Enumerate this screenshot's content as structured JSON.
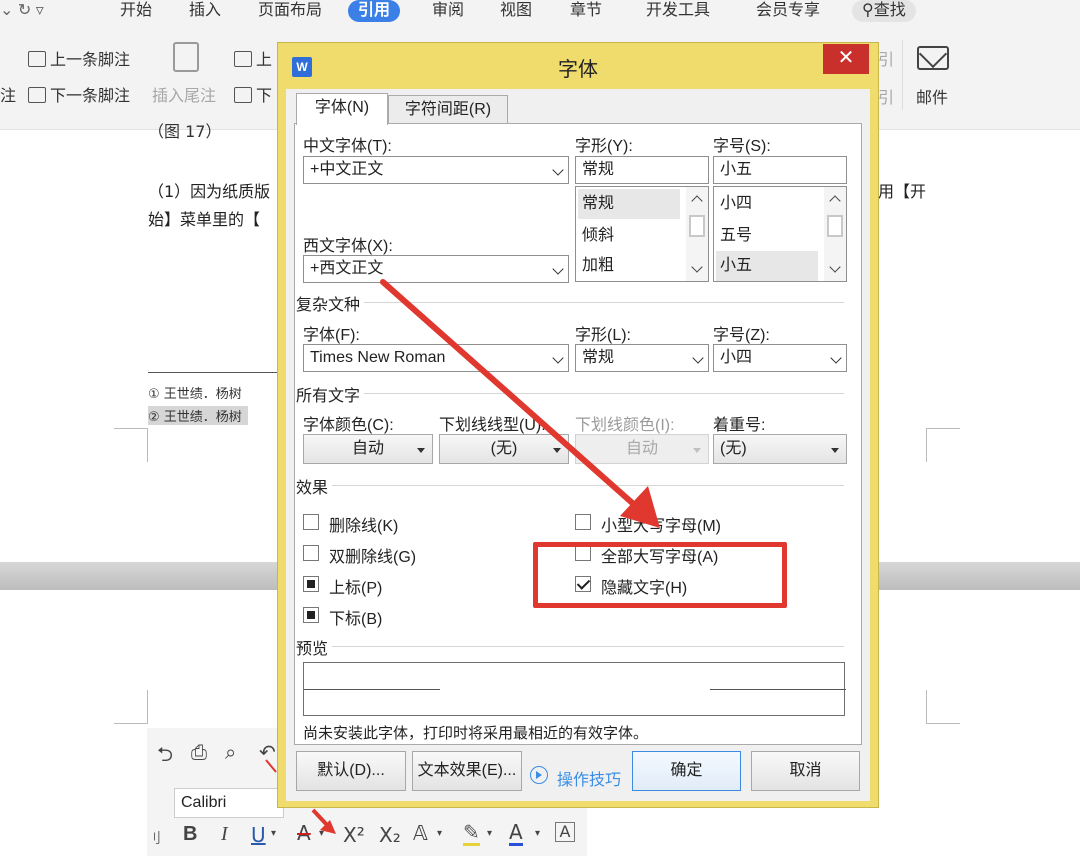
{
  "menu": {
    "items": [
      "开始",
      "插入",
      "页面布局",
      "引用",
      "审阅",
      "视图",
      "章节",
      "开发工具",
      "会员专享"
    ],
    "active": "引用",
    "search": "查找"
  },
  "ribbon": {
    "prev_footnote": "上一条脚注",
    "next_footnote": "下一条脚注",
    "insert_endnote": "插入尾注",
    "up_partial": "上",
    "down_partial": "下",
    "left_partial": "注",
    "mail": "邮件",
    "right_cut_1": "引",
    "right_cut_2": "引"
  },
  "document": {
    "caption": "（图 17）",
    "para_line1_left": "（1）因为纸质版",
    "para_line1_right": "用【开",
    "para_line2_left": "始】菜单里的【",
    "footnote1": "王世绩．杨树",
    "footnote2": "王世绩．杨树",
    "fn1_mark": "①",
    "fn2_mark": "②"
  },
  "mini_toolbar": {
    "font_name": "Calibri",
    "bold": "B",
    "italic": "I",
    "underline": "U",
    "superscript": "X²",
    "subscript": "X₂"
  },
  "dialog": {
    "logo": "W",
    "title": "字体",
    "close": "✕",
    "tabs": [
      "字体(N)",
      "字符间距(R)"
    ],
    "chinese_font": {
      "label": "中文字体(T):",
      "value": "+中文正文"
    },
    "style": {
      "label": "字形(Y):",
      "value": "常规",
      "options": [
        "常规",
        "倾斜",
        "加粗"
      ],
      "selected": "常规"
    },
    "size": {
      "label": "字号(S):",
      "value": "小五",
      "options": [
        "小四",
        "五号",
        "小五"
      ],
      "selected": "小五"
    },
    "western_font": {
      "label": "西文字体(X):",
      "value": "+西文正文"
    },
    "complex": {
      "section": "复杂文种",
      "font_label": "字体(F):",
      "font_value": "Times New Roman",
      "style_label": "字形(L):",
      "style_value": "常规",
      "size_label": "字号(Z):",
      "size_value": "小四"
    },
    "all_text": {
      "section": "所有文字",
      "color_label": "字体颜色(C):",
      "color_value": "自动",
      "underline_label": "下划线线型(U):",
      "underline_value": "(无)",
      "underline_color_label": "下划线颜色(I):",
      "underline_color_value": "自动",
      "emphasis_label": "着重号:",
      "emphasis_value": "(无)"
    },
    "effects": {
      "section": "效果",
      "strikethrough": "删除线(K)",
      "double_strikethrough": "双删除线(G)",
      "superscript": "上标(P)",
      "subscript": "下标(B)",
      "small_caps": "小型大写字母(M)",
      "all_caps": "全部大写字母(A)",
      "hidden": "隐藏文字(H)",
      "checks": {
        "strikethrough": false,
        "double_strikethrough": false,
        "superscript": "mixed",
        "subscript": "mixed",
        "small_caps": false,
        "all_caps": false,
        "hidden": true
      }
    },
    "preview": {
      "section": "预览",
      "note": "尚未安装此字体，打印时将采用最相近的有效字体。"
    },
    "buttons": {
      "default": "默认(D)...",
      "text_effects": "文本效果(E)...",
      "tips": "操作技巧",
      "ok": "确定",
      "cancel": "取消"
    }
  },
  "colors": {
    "dialog_frame": "#efdc6d",
    "close_button": "#c9302c",
    "annotation_red": "#e0372f",
    "active_tab": "#3b80e6",
    "link_blue": "#3a8ee6"
  }
}
